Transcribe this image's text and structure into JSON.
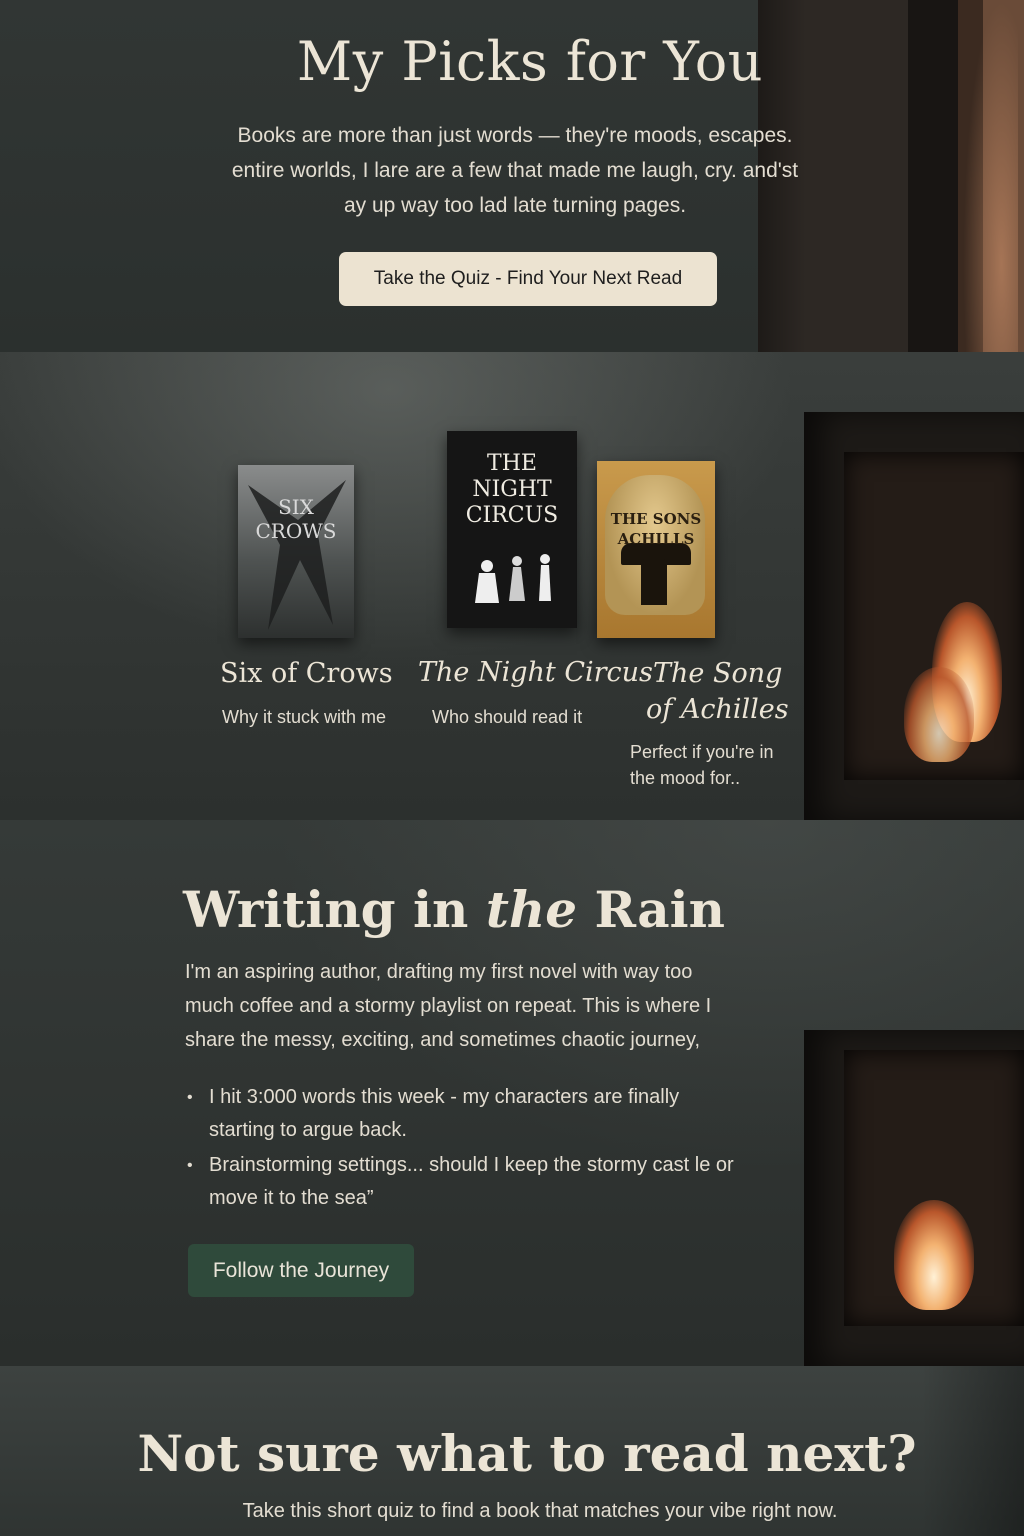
{
  "picks": {
    "title": "My Picks for You",
    "intro": "Books are more than just words —  they're moods, escapes. entire worlds, I lare are a few that made me laugh, cry. and'st ay up way too lad late turning pages.",
    "quiz_button": "Take the Quiz - Find Your Next Read"
  },
  "books": [
    {
      "title": "Six of Crows",
      "note": "Why it stuck with me",
      "cover_text": "SIX CROWS"
    },
    {
      "title": "The Night Circus",
      "note": "Who should read it",
      "cover_text": "THE NIGHT CIRCUS"
    },
    {
      "title": "The Song of Achilles",
      "note": "Perfect if you're in the mood for..",
      "cover_text": "THE SONS ACHILLS"
    }
  ],
  "writing": {
    "title_prefix": "Writing in",
    "title_italic": "the",
    "title_suffix": "Rain",
    "body": "I'm an aspiring author, drafting my first novel with way too much coffee and a stormy playlist on repeat. This is where I share the messy, exciting, and sometimes chaotic journey,",
    "updates": [
      "I hit 3:000 words this week - my characters are finally starting to argue back.",
      "Brainstorming settings... should I keep the stormy cast le or move it to the sea”"
    ],
    "follow_button": "Follow the Journey"
  },
  "quiz_section": {
    "title": "Not sure what to read next?",
    "subtitle": "Take this short quiz to find a book that matches your vibe right now."
  },
  "colors": {
    "background": "#2e3331",
    "quiz_button_bg": "#ece3d1",
    "follow_button_bg": "#2f4a3b",
    "heading_text": "#ece5d6"
  }
}
